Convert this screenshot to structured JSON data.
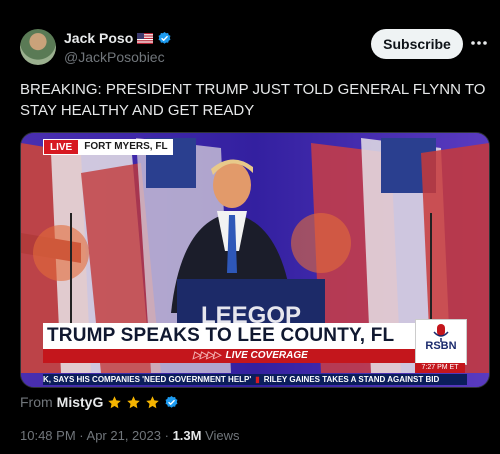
{
  "author": {
    "display_name": "Jack Poso",
    "handle": "@JackPosobiec",
    "flag": "us-flag-icon",
    "verified": true
  },
  "actions": {
    "subscribe_label": "Subscribe",
    "more": "more-icon"
  },
  "tweet": {
    "text": "BREAKING: PRESIDENT TRUMP JUST TOLD GENERAL FLYNN TO STAY HEALTHY AND GET READY"
  },
  "video": {
    "live_label": "LIVE",
    "location": "FORT MYERS, FL",
    "podium_text": "LEEGOP",
    "headline": "TRUMP SPEAKS TO LEE COUNTY, FL",
    "subline_arrows": "▷▷▷▷",
    "subline": "LIVE COVERAGE",
    "network": "RSBN",
    "network_time": "7:27 PM ET",
    "ticker_items": [
      "K, SAYS HIS COMPANIES 'NEED GOVERNMENT HELP'",
      "RILEY GAINES TAKES A STAND AGAINST BID"
    ]
  },
  "source": {
    "from_label": "From",
    "name": "MistyG"
  },
  "meta": {
    "time": "10:48 PM",
    "date": "Apr 21, 2023",
    "separator": "·",
    "views_count": "1.3M",
    "views_label": "Views"
  },
  "colors": {
    "background": "#000000",
    "text": "#e7e9ea",
    "secondary": "#71767b",
    "verified_blue": "#1d9bf0",
    "star_gold": "#f5b400",
    "stage_purple": "#3a2a9e",
    "banner_red": "#c4161c",
    "ticker_navy": "#0b1e5b"
  }
}
